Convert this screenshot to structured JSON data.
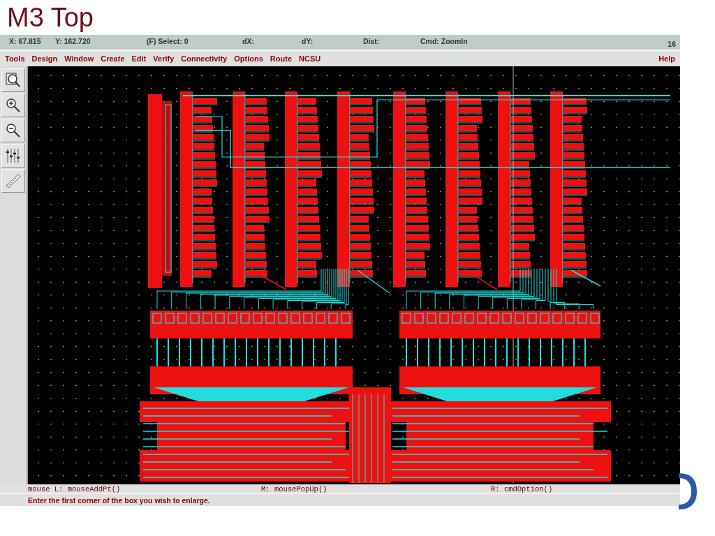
{
  "slide": {
    "title": "M3 Top"
  },
  "window": {
    "status_bar": [
      {
        "kind": "x",
        "text": "X: 67.815"
      },
      {
        "kind": "y",
        "text": "Y: 162.720"
      },
      {
        "kind": "select",
        "text": "(F) Select: 0"
      },
      {
        "kind": "dx",
        "text": "dX:"
      },
      {
        "kind": "dy",
        "text": "dY:"
      },
      {
        "kind": "dist",
        "text": "Dist:"
      },
      {
        "kind": "cmd",
        "text": "Cmd: ZoomIn"
      }
    ],
    "window_number": "16",
    "menu": [
      "Tools",
      "Design",
      "Window",
      "Create",
      "Edit",
      "Verify",
      "Connectivity",
      "Options",
      "Route",
      "NCSU"
    ],
    "help": "Help",
    "mouse_bindings": [
      "mouse L: mouseAddPt()",
      "M: mousePopUp()",
      "R: cmdOption()"
    ],
    "prompt": "Enter the first corner of the box you wish to enlarge."
  }
}
